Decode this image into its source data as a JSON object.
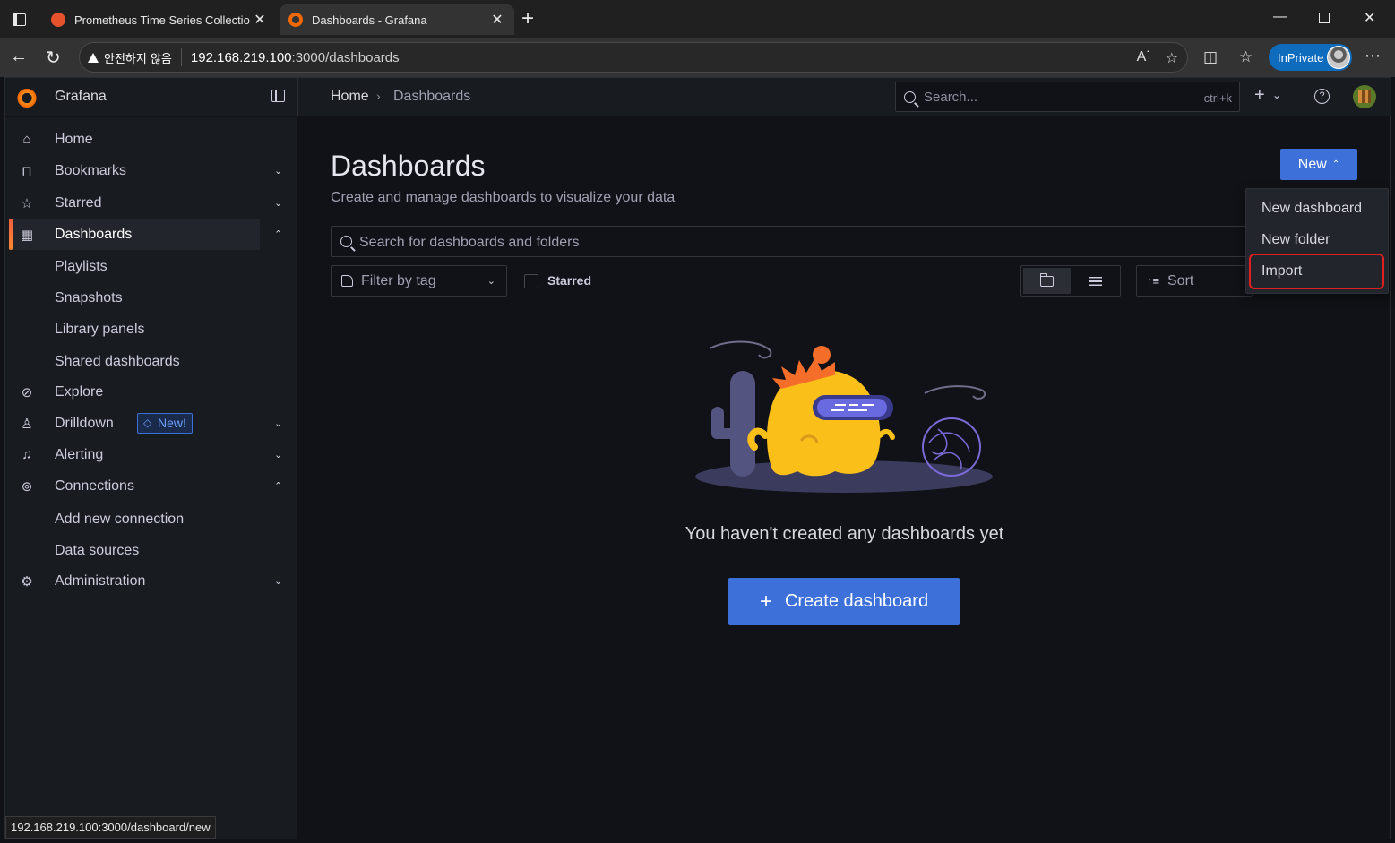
{
  "browser": {
    "tabs": [
      {
        "title": "Prometheus Time Series Collectio",
        "active": false
      },
      {
        "title": "Dashboards - Grafana",
        "active": true
      }
    ],
    "security_label": "안전하지 않음",
    "url_host": "192.168.219.100",
    "url_rest": ":3000/dashboards",
    "inprivate_label": "InPrivate",
    "status_url": "192.168.219.100:3000/dashboard/new"
  },
  "topnav": {
    "brand": "Grafana",
    "breadcrumb_home": "Home",
    "breadcrumb_separator": "›",
    "breadcrumb_current": "Dashboards",
    "search_placeholder": "Search...",
    "search_shortcut": "ctrl+k",
    "add_label": "+",
    "help_label": "?"
  },
  "sidebar": {
    "items": [
      {
        "label": "Home",
        "icon": "home-icon"
      },
      {
        "label": "Bookmarks",
        "icon": "bookmark-icon"
      },
      {
        "label": "Starred",
        "icon": "star-icon"
      },
      {
        "label": "Dashboards",
        "icon": "apps-icon",
        "active": true
      },
      {
        "label": "Explore",
        "icon": "compass-icon"
      },
      {
        "label": "Drilldown",
        "icon": "drilldown-icon",
        "badge": "New!"
      },
      {
        "label": "Alerting",
        "icon": "bell-icon"
      },
      {
        "label": "Connections",
        "icon": "connections-icon"
      },
      {
        "label": "Administration",
        "icon": "cog-icon"
      }
    ],
    "dashboards_children": [
      "Playlists",
      "Snapshots",
      "Library panels",
      "Shared dashboards"
    ],
    "connections_children": [
      "Add new connection",
      "Data sources"
    ]
  },
  "main": {
    "title": "Dashboards",
    "subtitle": "Create and manage dashboards to visualize your data",
    "new_button": "New",
    "new_menu": [
      "New dashboard",
      "New folder",
      "Import"
    ],
    "search_placeholder": "Search for dashboards and folders",
    "tag_filter_placeholder": "Filter by tag",
    "starred_label": "Starred",
    "sort_placeholder": "Sort",
    "empty_message": "You haven't created any dashboards yet",
    "create_button": "Create dashboard"
  },
  "colors": {
    "primary": "#3d71d9",
    "accent": "#f46800",
    "highlight": "#e02020",
    "background": "#111217"
  }
}
